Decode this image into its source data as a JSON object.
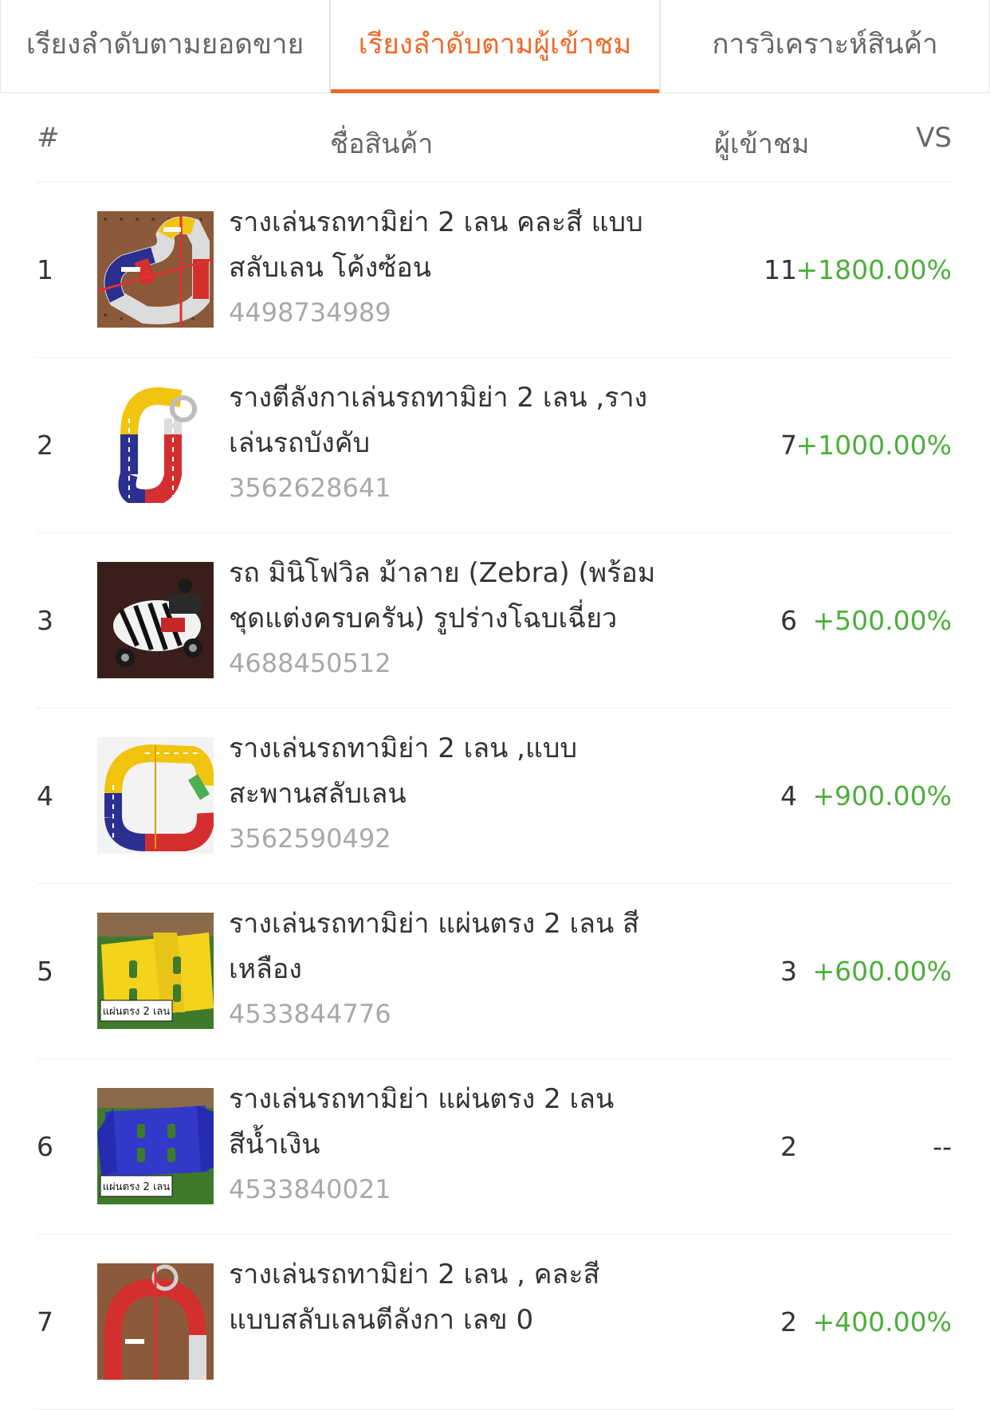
{
  "tabs": [
    {
      "label": "เรียงลำดับตามยอดขาย",
      "active": false
    },
    {
      "label": "เรียงลำดับตามผู้เข้าชม",
      "active": true
    },
    {
      "label": "การวิเคราะห์สินค้า",
      "active": false
    }
  ],
  "table": {
    "headers": {
      "rank": "#",
      "name": "ชื่อสินค้า",
      "visitors": "ผู้เข้าชม",
      "vs": "VS"
    },
    "rows": [
      {
        "rank": "1",
        "name": "รางเล่นรถทามิย่า 2 เลน คละสี แบบสลับเลน โค้งซ้อน",
        "id": "4498734989",
        "visitors": "11",
        "vs": "+1800.00%",
        "thumb": "track-image"
      },
      {
        "rank": "2",
        "name": "รางตีลังกาเล่นรถทามิย่า 2 เลน ,รางเล่นรถบังคับ",
        "id": "3562628641",
        "visitors": "7",
        "vs": "+1000.00%",
        "thumb": "loop-track-image"
      },
      {
        "rank": "3",
        "name": "รถ มินิโฟวิล ม้าลาย (Zebra) (พร้อมชุดแต่งครบครัน) รูปร่างโฉบเฉี่ยว",
        "id": "4688450512",
        "visitors": "6",
        "vs": "+500.00%",
        "thumb": "zebra-car-image"
      },
      {
        "rank": "4",
        "name": "รางเล่นรถทามิย่า 2 เลน ,แบบสะพานสลับเลน",
        "id": "3562590492",
        "visitors": "4",
        "vs": "+900.00%",
        "thumb": "oval-track-image"
      },
      {
        "rank": "5",
        "name": "รางเล่นรถทามิย่า แผ่นตรง 2 เลน สีเหลือง",
        "id": "4533844776",
        "visitors": "3",
        "vs": "+600.00%",
        "thumb": "yellow-plate-image",
        "thumb_label": "แผ่นตรง 2 เลน"
      },
      {
        "rank": "6",
        "name": "รางเล่นรถทามิย่า แผ่นตรง 2 เลน สีน้ำเงิน",
        "id": "4533840021",
        "visitors": "2",
        "vs": "--",
        "thumb": "blue-plate-image",
        "thumb_label": "แผ่นตรง 2 เลน"
      },
      {
        "rank": "7",
        "name": "รางเล่นรถทามิย่า 2 เลน , คละสี แบบสลับเลนตีลังกา เลข 0",
        "id": "",
        "visitors": "2",
        "vs": "+400.00%",
        "thumb": "loop-zero-track-image"
      }
    ]
  },
  "colors": {
    "accent": "#ee6a2b",
    "positive": "#4caf3a",
    "muted": "#a8a8a8"
  }
}
